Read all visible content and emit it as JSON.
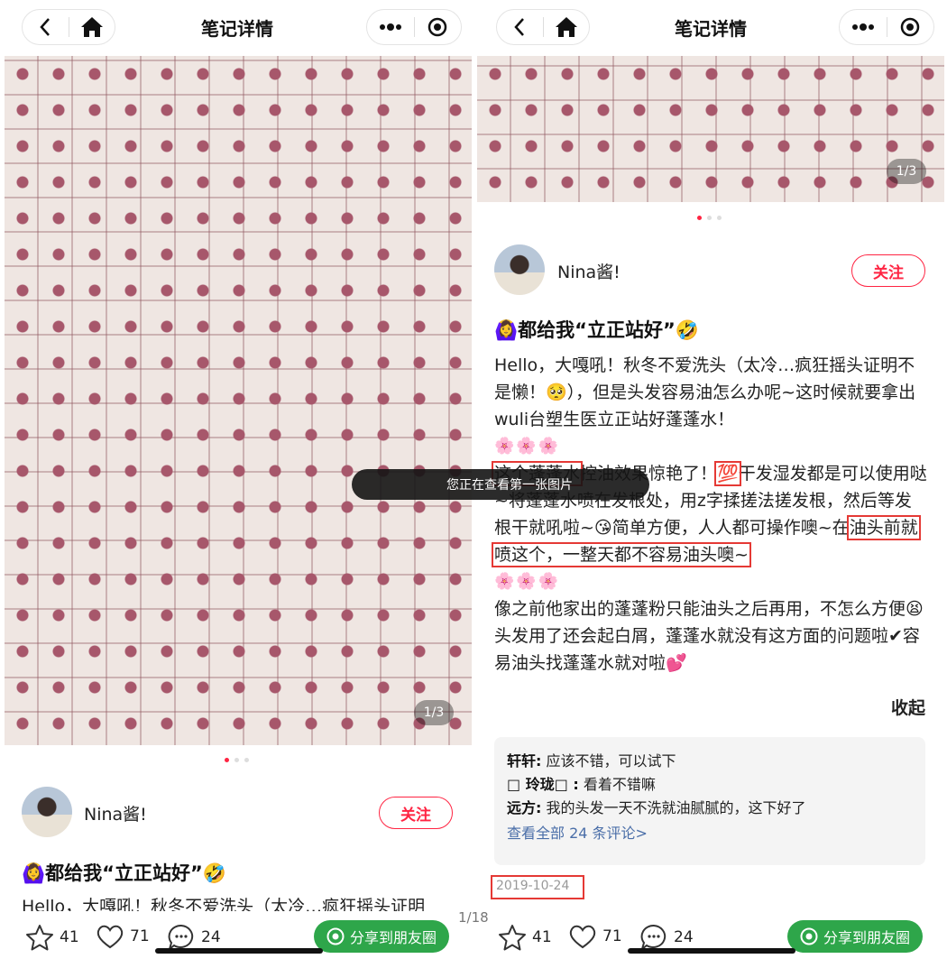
{
  "left": {
    "nav_title": "笔记详情",
    "photo_counter": "1/3",
    "author_name": "Nina酱!",
    "follow_label": "关注",
    "note_title": "🙆‍♀️都给我“立正站好”🤣",
    "body_preview": "Hello，大嘎吼！秋冬不爱洗头（太冷…疯狂摇头证明",
    "bottom": {
      "stars": "41",
      "likes": "71",
      "comments": "24",
      "share_label": "分享到朋友圈"
    }
  },
  "right": {
    "nav_title": "笔记详情",
    "photo_counter": "1/3",
    "author_name": "Nina酱!",
    "follow_label": "关注",
    "note_title": "🙆‍♀️都给我“立正站好”🤣",
    "body": {
      "p1": "Hello，大嘎吼！秋冬不爱洗头（太冷…疯狂摇头证明不是懒！🥺），但是头发容易油怎么办呢~这时候就要拿出wuli台塑生医立正站好蓬蓬水！",
      "flowers1": "🌸🌸🌸",
      "p2_highlight": "这个蓬蓬水",
      "p2_a": "控油效果惊艳了！",
      "p2_b": "💯",
      "p2_c": "干发湿发都是可以使用哒~将蓬蓬水喷在发根处，用z字揉搓法搓发根，然后等发根干就吼啦~😘简单方便，人人都可操作噢~在",
      "p2_highlight2": "油头前就喷这个，一整天都不容易油头噢~",
      "flowers2": "🌸🌸🌸",
      "p3": "像之前他家出的蓬蓬粉只能油头之后再用，不怎么方便😫头发用了还会起白屑，蓬蓬水就没有这方面的问题啦✔容易油头找蓬蓬水就对啦💕"
    },
    "collapse_label": "收起",
    "comments": [
      {
        "user": "轩轩:",
        "text": "应该不错，可以试下"
      },
      {
        "user": "□ 玲珑□ :",
        "text": "看着不错嘛"
      },
      {
        "user": "远方:",
        "text": "我的头发一天不洗就油腻腻的，这下好了"
      }
    ],
    "view_all_comments": "查看全部 24 条评论>",
    "date": "2019-10-24",
    "bottom": {
      "stars": "41",
      "likes": "71",
      "comments": "24",
      "share_label": "分享到朋友圈"
    }
  },
  "overlay": {
    "toast": "您正在查看第一张图片",
    "page_counter": "1/18"
  },
  "icons": {
    "back": "chevron-left-icon",
    "home": "home-icon",
    "more": "more-icon",
    "target": "target-icon",
    "star": "star-icon",
    "heart": "heart-icon",
    "comment": "comment-icon",
    "share": "shutter-icon"
  },
  "colors": {
    "accent": "#ff2442",
    "share_green": "#2ea64a",
    "link": "#4a6ea8",
    "highlight_box": "#e53935"
  }
}
